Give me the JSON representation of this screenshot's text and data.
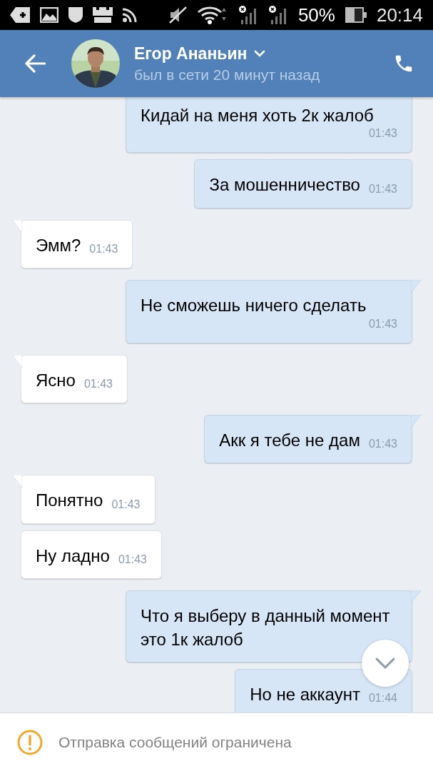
{
  "status_bar": {
    "battery": "50%",
    "time": "20:14"
  },
  "header": {
    "name": "Егор Ананьин",
    "status": "был в сети 20 минут назад"
  },
  "messages": [
    {
      "kind": "outgoing",
      "text": "Кидай на меня хоть 2к жалоб",
      "time": "01:43",
      "tail": false
    },
    {
      "kind": "outgoing",
      "text": "За мошенничество",
      "time": "01:43",
      "tail": false
    },
    {
      "kind": "incoming",
      "text": "Эмм?",
      "time": "01:43",
      "tail": true
    },
    {
      "kind": "outgoing",
      "text": "Не сможешь ничего сделать",
      "time": "01:43",
      "tail": true
    },
    {
      "kind": "incoming",
      "text": "Ясно",
      "time": "01:43",
      "tail": true
    },
    {
      "kind": "outgoing",
      "text": "Акк я тебе не дам",
      "time": "01:43",
      "tail": true
    },
    {
      "kind": "incoming",
      "text": "Понятно",
      "time": "01:43",
      "tail": true
    },
    {
      "kind": "incoming",
      "text": "Ну ладно",
      "time": "01:43",
      "tail": false
    },
    {
      "kind": "outgoing",
      "text": "Что я выберу в данный момент это 1к жалоб",
      "tail": true
    },
    {
      "kind": "outgoing",
      "text": "Но не аккаунт",
      "time": "01:44",
      "tail": false
    }
  ],
  "footer": {
    "notice": "Отправка сообщений ограничена"
  }
}
